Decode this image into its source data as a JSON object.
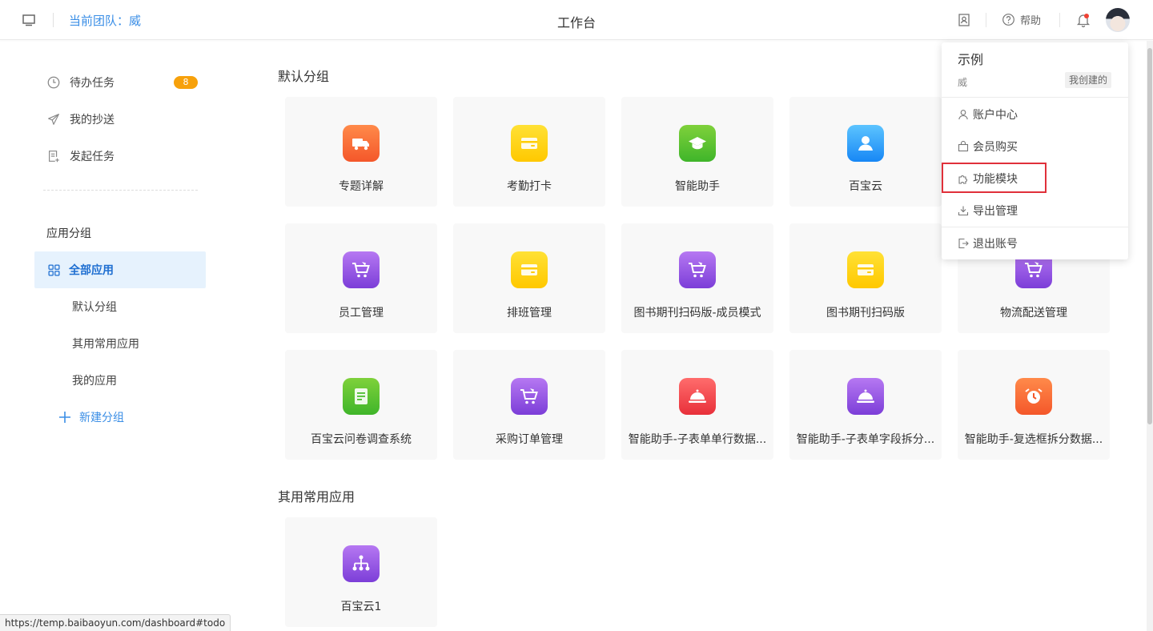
{
  "header": {
    "team_label": "当前团队：威",
    "title": "工作台",
    "help_label": "帮助"
  },
  "sidebar": {
    "todo_label": "待办任务",
    "todo_count": "8",
    "cc_label": "我的抄送",
    "start_label": "发起任务",
    "group_title": "应用分组",
    "all_apps": "全部应用",
    "groups": [
      "默认分组",
      "其用常用应用",
      "我的应用"
    ],
    "new_group": "新建分组"
  },
  "sections": [
    {
      "title": "默认分组",
      "apps": [
        {
          "label": "专题详解",
          "icon": "truck-icon",
          "color": "orange"
        },
        {
          "label": "考勤打卡",
          "icon": "card-icon",
          "color": "yellow"
        },
        {
          "label": "智能助手",
          "icon": "graduation-cap-icon",
          "color": "green"
        },
        {
          "label": "百宝云",
          "icon": "user-icon",
          "color": "blue"
        },
        {
          "label": "",
          "icon": "",
          "color": ""
        },
        {
          "label": "员工管理",
          "icon": "cart-icon",
          "color": "purple"
        },
        {
          "label": "排班管理",
          "icon": "card-icon",
          "color": "yellow"
        },
        {
          "label": "图书期刊扫码版-成员模式",
          "icon": "cart-icon",
          "color": "purple"
        },
        {
          "label": "图书期刊扫码版",
          "icon": "card-icon",
          "color": "yellow"
        },
        {
          "label": "物流配送管理",
          "icon": "cart-icon",
          "color": "purple"
        },
        {
          "label": "百宝云问卷调查系统",
          "icon": "document-icon",
          "color": "green"
        },
        {
          "label": "采购订单管理",
          "icon": "cart-icon",
          "color": "purple"
        },
        {
          "label": "智能助手-子表单单行数据...",
          "icon": "cloche-icon",
          "color": "red"
        },
        {
          "label": "智能助手-子表单字段拆分...",
          "icon": "cloche-icon",
          "color": "purple"
        },
        {
          "label": "智能助手-复选框拆分数据...",
          "icon": "alarm-clock-icon",
          "color": "orange"
        }
      ]
    },
    {
      "title": "其用常用应用",
      "apps": [
        {
          "label": "百宝云1",
          "icon": "org-chart-icon",
          "color": "purple"
        }
      ]
    }
  ],
  "dropdown": {
    "name": "示例",
    "user": "威",
    "tag": "我创建的",
    "items": [
      "账户中心",
      "会员购买",
      "功能模块",
      "导出管理",
      "退出账号"
    ]
  },
  "status_url": "https://temp.baibaoyun.com/dashboard#todo"
}
